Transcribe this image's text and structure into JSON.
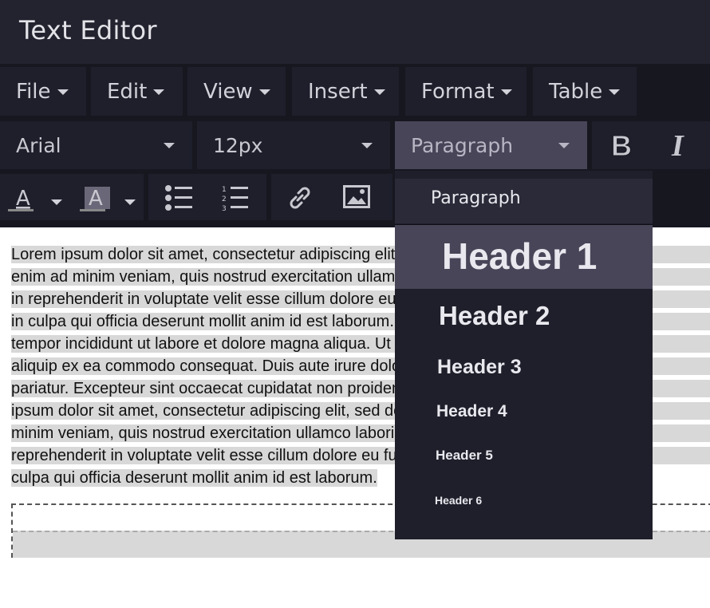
{
  "window": {
    "title": "Text Editor"
  },
  "menubar": {
    "items": [
      {
        "label": "File"
      },
      {
        "label": "Edit"
      },
      {
        "label": "View"
      },
      {
        "label": "Insert"
      },
      {
        "label": "Format"
      },
      {
        "label": "Table"
      }
    ]
  },
  "toolbar": {
    "font_family": "Arial",
    "font_size": "12px",
    "block_format": "Paragraph",
    "bold_icon": "bold-icon",
    "italic_icon": "italic-icon",
    "text_color_icon": "text-color-icon",
    "highlight_icon": "background-color-icon",
    "bullet_list_icon": "bullet-list-icon",
    "numbered_list_icon": "numbered-list-icon",
    "link_icon": "link-icon",
    "image_icon": "image-icon"
  },
  "editor": {
    "lines": [
      "Lorem ipsum dolor sit amet, consectetur adipiscing elit, sed do eiusmod tempor inc",
      "enim ad minim veniam, quis nostrud exercitation ullamco laboris nisi ut aliquip ex e",
      "in reprehenderit in voluptate velit esse cillum dolore eu fugiat nulla pariatur. Except",
      "in culpa qui officia deserunt mollit anim id est laborum. Lorem ipsum dolor sit amet,",
      "tempor incididunt ut labore et dolore magna aliqua. Ut enim ad minim veniam, quis",
      "aliquip ex ea commodo consequat. Duis aute irure dolor in reprehenderit in voluptat",
      "pariatur. Excepteur sint occaecat cupidatat non proident, sunt in culpa qui officia de",
      "ipsum dolor sit amet, consectetur adipiscing elit, sed do eiusmod tempor incididunt",
      "minim veniam, quis nostrud exercitation ullamco laboris nisi ut aliquip ex ea commo",
      "reprehenderit in voluptate velit esse cillum dolore eu fugiat nulla pariatur. Excepteu",
      "culpa qui officia deserunt mollit anim id est laborum."
    ]
  },
  "dropdown": {
    "items": [
      {
        "label": "Paragraph"
      },
      {
        "label": "Header 1"
      },
      {
        "label": "Header 2"
      },
      {
        "label": "Header 3"
      },
      {
        "label": "Header 4"
      },
      {
        "label": "Header 5"
      },
      {
        "label": "Header 6"
      }
    ],
    "highlighted": "Header 1"
  },
  "colors": {
    "titlebar_bg": "#22232f",
    "toolbar_bg": "#1e1f2b",
    "active_bg": "#484558",
    "selection_bg": "#d8d8d8"
  }
}
